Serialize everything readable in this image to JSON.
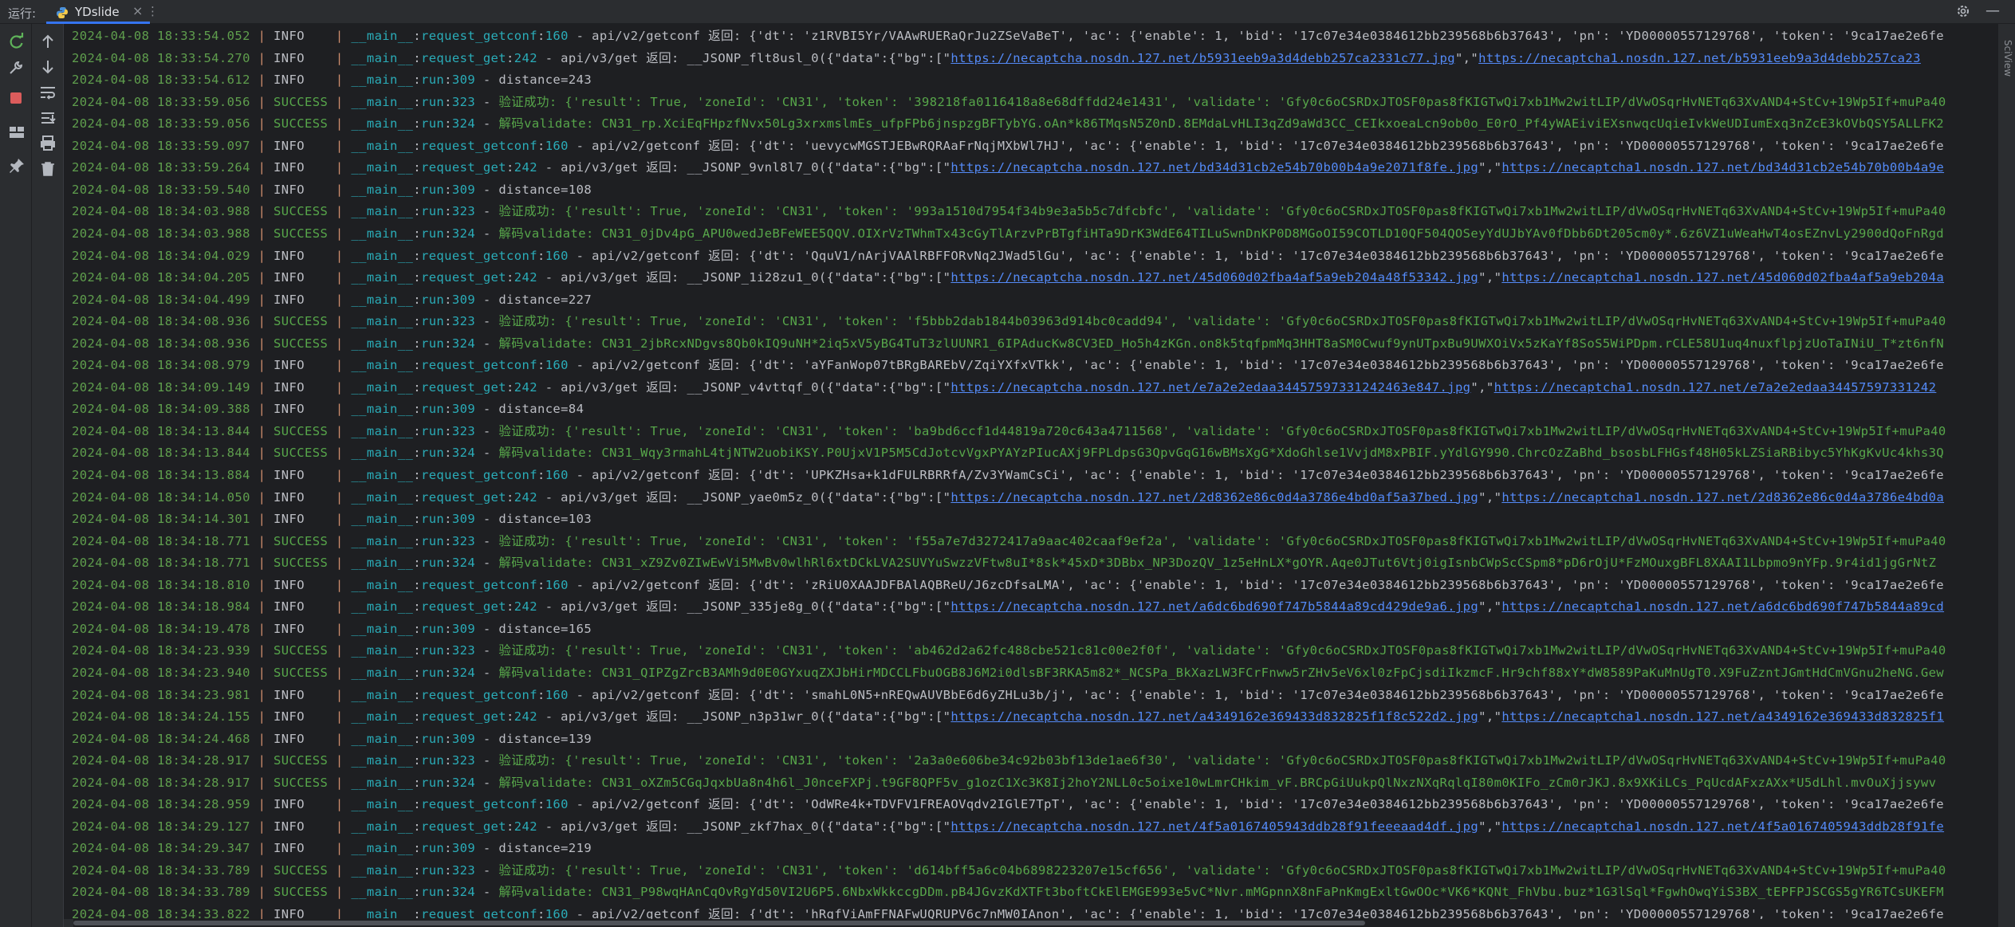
{
  "header": {
    "run_label": "运行:",
    "tab_title": "YDslide",
    "tab_close": "×",
    "tab_menu": "⋮",
    "minimize": "—"
  },
  "right_strip_label": "SciView",
  "icons": {
    "rerun": "rerun-icon",
    "settings": "wrench-icon",
    "stop": "stop-icon",
    "layout": "layout-icon",
    "pin": "pin-icon",
    "up": "arrow-up-icon",
    "down": "arrow-down-icon",
    "softwrap": "soft-wrap-icon",
    "scroll_end": "scroll-to-end-icon",
    "print": "print-icon",
    "trash": "trash-icon",
    "gear": "gear-icon",
    "python": "python-icon"
  },
  "colors": {
    "accent": "#3574f0",
    "success": "#57a64a",
    "timestamp": "#5f9e4d",
    "link": "#548af7",
    "stop": "#db5c5c"
  },
  "console": {
    "lines": [
      {
        "ts": "2024-04-08 18:33:54.052",
        "level": "INFO   ",
        "fn": "request_getconf",
        "ln": "160",
        "msg": "api/v2/getconf 返回: {'dt': 'z1RVBI5Yr/VAAwRUERaQrJu2ZSeVaBeT', 'ac': {'enable': 1, 'bid': '17c07e34e0384612bb239568b6b37643', 'pn': 'YD00000557129768', 'token': '9ca17ae2e6fe",
        "urls": []
      },
      {
        "ts": "2024-04-08 18:33:54.270",
        "level": "INFO   ",
        "fn": "request_get",
        "ln": "242",
        "msg": "api/v3/get 返回: __JSONP_flt8usl_0({\"data\":{\"bg\":[\"",
        "urls": [
          "https://necaptcha.nosdn.127.net/b5931eeb9a3d4debb257ca2331c77.jpg",
          "\",\"",
          "https://necaptcha1.nosdn.127.net/b5931eeb9a3d4debb257ca23"
        ]
      },
      {
        "ts": "2024-04-08 18:33:54.612",
        "level": "INFO   ",
        "fn": "run",
        "ln": "309",
        "msg": "distance=243",
        "urls": []
      },
      {
        "ts": "2024-04-08 18:33:59.056",
        "level": "SUCCESS",
        "fn": "run",
        "ln": "323",
        "msg": "验证成功: {'result': True, 'zoneId': 'CN31', 'token': '398218fa0116418a8e68dffdd24e1431', 'validate': 'Gfy0c6oCSRDxJTOSF0pas8fKIGTwQi7xb1Mw2witLIP/dVwOSqrHvNETq63XvAND4+StCv+19Wp5If+muPa40",
        "urls": []
      },
      {
        "ts": "2024-04-08 18:33:59.056",
        "level": "SUCCESS",
        "fn": "run",
        "ln": "324",
        "msg": "解码validate: CN31_rp.XciEqFHpzfNvx50Lg3xrxmslmEs_ufpFPb6jnspzgBFTybYG.oAn*k86TMqsN5Z0nD.8EMdaLvHLI3qZd9aWd3CC_CEIkxoeaLcn9ob0o_E0rO_Pf4yWAEiviEXsnwqcUqieIvkWeUDIumExq3nZcE3kOVbQSY5ALLFK2",
        "urls": []
      },
      {
        "ts": "2024-04-08 18:33:59.097",
        "level": "INFO   ",
        "fn": "request_getconf",
        "ln": "160",
        "msg": "api/v2/getconf 返回: {'dt': 'uevycwMGSTJEBwRQRAaFrNqjMXbWl7HJ', 'ac': {'enable': 1, 'bid': '17c07e34e0384612bb239568b6b37643', 'pn': 'YD00000557129768', 'token': '9ca17ae2e6fe",
        "urls": []
      },
      {
        "ts": "2024-04-08 18:33:59.264",
        "level": "INFO   ",
        "fn": "request_get",
        "ln": "242",
        "msg": "api/v3/get 返回: __JSONP_9vnl8l7_0({\"data\":{\"bg\":[\"",
        "urls": [
          "https://necaptcha.nosdn.127.net/bd34d31cb2e54b70b00b4a9e2071f8fe.jpg",
          "\",\"",
          "https://necaptcha1.nosdn.127.net/bd34d31cb2e54b70b00b4a9e"
        ]
      },
      {
        "ts": "2024-04-08 18:33:59.540",
        "level": "INFO   ",
        "fn": "run",
        "ln": "309",
        "msg": "distance=108",
        "urls": []
      },
      {
        "ts": "2024-04-08 18:34:03.988",
        "level": "SUCCESS",
        "fn": "run",
        "ln": "323",
        "msg": "验证成功: {'result': True, 'zoneId': 'CN31', 'token': '993a1510d7954f34b9e3a5b5c7dfcbfc', 'validate': 'Gfy0c6oCSRDxJTOSF0pas8fKIGTwQi7xb1Mw2witLIP/dVwOSqrHvNETq63XvAND4+StCv+19Wp5If+muPa40",
        "urls": []
      },
      {
        "ts": "2024-04-08 18:34:03.988",
        "level": "SUCCESS",
        "fn": "run",
        "ln": "324",
        "msg": "解码validate: CN31_0jDv4pG_APU0wedJeBFeWEE5QQV.OIXrVzTWhmTx43cGyTlArzvPrBTgfiHTa9DrK3WdE64TILuSwnDnKP0D8MGoOI59COTLD10QF504QOSeyYdUJbYAv0fDbb6Dt205cm0y*.6z6VZ1uWeaHwT4osEZnvLy2900dQoFnRgd",
        "urls": []
      },
      {
        "ts": "2024-04-08 18:34:04.029",
        "level": "INFO   ",
        "fn": "request_getconf",
        "ln": "160",
        "msg": "api/v2/getconf 返回: {'dt': 'QquV1/nArjVAAlRBFFORvNq2JWad5lGu', 'ac': {'enable': 1, 'bid': '17c07e34e0384612bb239568b6b37643', 'pn': 'YD00000557129768', 'token': '9ca17ae2e6fe",
        "urls": []
      },
      {
        "ts": "2024-04-08 18:34:04.205",
        "level": "INFO   ",
        "fn": "request_get",
        "ln": "242",
        "msg": "api/v3/get 返回: __JSONP_1i28zu1_0({\"data\":{\"bg\":[\"",
        "urls": [
          "https://necaptcha.nosdn.127.net/45d060d02fba4af5a9eb204a48f53342.jpg",
          "\",\"",
          "https://necaptcha1.nosdn.127.net/45d060d02fba4af5a9eb204a"
        ]
      },
      {
        "ts": "2024-04-08 18:34:04.499",
        "level": "INFO   ",
        "fn": "run",
        "ln": "309",
        "msg": "distance=227",
        "urls": []
      },
      {
        "ts": "2024-04-08 18:34:08.936",
        "level": "SUCCESS",
        "fn": "run",
        "ln": "323",
        "msg": "验证成功: {'result': True, 'zoneId': 'CN31', 'token': 'f5bbb2dab1844b03963d914bc0cadd94', 'validate': 'Gfy0c6oCSRDxJTOSF0pas8fKIGTwQi7xb1Mw2witLIP/dVwOSqrHvNETq63XvAND4+StCv+19Wp5If+muPa40",
        "urls": []
      },
      {
        "ts": "2024-04-08 18:34:08.936",
        "level": "SUCCESS",
        "fn": "run",
        "ln": "324",
        "msg": "解码validate: CN31_2jbRcxNDgvs8Qb0kIQ9uNH*2iq5xV5yBG4TuT3zlUUNR1_6IPAducKw8CV3ED_Ho5h4zKGn.on8k5tqfpmMq3HHT8aSM0Cwuf9ynUTpxBu9UWXOiVx5zKaYf8SoS5WiPDpm.rCLE58U1uq4nuxflpjzUoTaINiU_T*zt6nfN",
        "urls": []
      },
      {
        "ts": "2024-04-08 18:34:08.979",
        "level": "INFO   ",
        "fn": "request_getconf",
        "ln": "160",
        "msg": "api/v2/getconf 返回: {'dt': 'aYFanWop07tBRgBAREbV/ZqiYXfxVTkk', 'ac': {'enable': 1, 'bid': '17c07e34e0384612bb239568b6b37643', 'pn': 'YD00000557129768', 'token': '9ca17ae2e6fe",
        "urls": []
      },
      {
        "ts": "2024-04-08 18:34:09.149",
        "level": "INFO   ",
        "fn": "request_get",
        "ln": "242",
        "msg": "api/v3/get 返回: __JSONP_v4vttqf_0({\"data\":{\"bg\":[\"",
        "urls": [
          "https://necaptcha.nosdn.127.net/e7a2e2edaa34457597331242463e847.jpg",
          "\",\"",
          "https://necaptcha1.nosdn.127.net/e7a2e2edaa34457597331242"
        ]
      },
      {
        "ts": "2024-04-08 18:34:09.388",
        "level": "INFO   ",
        "fn": "run",
        "ln": "309",
        "msg": "distance=84",
        "urls": []
      },
      {
        "ts": "2024-04-08 18:34:13.844",
        "level": "SUCCESS",
        "fn": "run",
        "ln": "323",
        "msg": "验证成功: {'result': True, 'zoneId': 'CN31', 'token': 'ba9bd6ccf1d44819a720c643a4711568', 'validate': 'Gfy0c6oCSRDxJTOSF0pas8fKIGTwQi7xb1Mw2witLIP/dVwOSqrHvNETq63XvAND4+StCv+19Wp5If+muPa40",
        "urls": []
      },
      {
        "ts": "2024-04-08 18:34:13.844",
        "level": "SUCCESS",
        "fn": "run",
        "ln": "324",
        "msg": "解码validate: CN31_Wqy3rmahL4tjNTW2uobiKSY.P0UjxV1P5M5CdJotcvVgxPYAYzPIucAXj9FPLdpsG3QpvGqG16wBMsXgG*XdoGhlse1VvjdM8xPBIF.yYdlGY990.ChrcOzZaBhd_bsosbLFHGsf48H05kLZSiaRBibyc5YhKgKvUc4khs3Q",
        "urls": []
      },
      {
        "ts": "2024-04-08 18:34:13.884",
        "level": "INFO   ",
        "fn": "request_getconf",
        "ln": "160",
        "msg": "api/v2/getconf 返回: {'dt': 'UPKZHsa+k1dFULRBRRfA/Zv3YWamCsCi', 'ac': {'enable': 1, 'bid': '17c07e34e0384612bb239568b6b37643', 'pn': 'YD00000557129768', 'token': '9ca17ae2e6fe",
        "urls": []
      },
      {
        "ts": "2024-04-08 18:34:14.050",
        "level": "INFO   ",
        "fn": "request_get",
        "ln": "242",
        "msg": "api/v3/get 返回: __JSONP_yae0m5z_0({\"data\":{\"bg\":[\"",
        "urls": [
          "https://necaptcha.nosdn.127.net/2d8362e86c0d4a3786e4bd0af5a37bed.jpg",
          "\",\"",
          "https://necaptcha1.nosdn.127.net/2d8362e86c0d4a3786e4bd0a"
        ]
      },
      {
        "ts": "2024-04-08 18:34:14.301",
        "level": "INFO   ",
        "fn": "run",
        "ln": "309",
        "msg": "distance=103",
        "urls": []
      },
      {
        "ts": "2024-04-08 18:34:18.771",
        "level": "SUCCESS",
        "fn": "run",
        "ln": "323",
        "msg": "验证成功: {'result': True, 'zoneId': 'CN31', 'token': 'f55a7e7d3272417a9aac402caaf9ef2a', 'validate': 'Gfy0c6oCSRDxJTOSF0pas8fKIGTwQi7xb1Mw2witLIP/dVwOSqrHvNETq63XvAND4+StCv+19Wp5If+muPa40",
        "urls": []
      },
      {
        "ts": "2024-04-08 18:34:18.771",
        "level": "SUCCESS",
        "fn": "run",
        "ln": "324",
        "msg": "解码validate: CN31_xZ9Zv0ZIwEwVi5MwBv0wlhRl6xtDCkLVA2SUVYuSwzzVFtw8uI*8sk*45xD*3DBbx_NP3DozQV_1z5eHnLX*gOYR.Aqe0JTut6Vtj0igIsnbCWpScCSpm8*pD6rOjU*FzMOuxgBFL8XAAI1Lbpmo9nYFp.9r4id1jgGrNtZ",
        "urls": []
      },
      {
        "ts": "2024-04-08 18:34:18.810",
        "level": "INFO   ",
        "fn": "request_getconf",
        "ln": "160",
        "msg": "api/v2/getconf 返回: {'dt': 'zRiU0XAAJDFBAlAQBReU/J6zcDfsaLMA', 'ac': {'enable': 1, 'bid': '17c07e34e0384612bb239568b6b37643', 'pn': 'YD00000557129768', 'token': '9ca17ae2e6fe",
        "urls": []
      },
      {
        "ts": "2024-04-08 18:34:18.984",
        "level": "INFO   ",
        "fn": "request_get",
        "ln": "242",
        "msg": "api/v3/get 返回: __JSONP_335je8g_0({\"data\":{\"bg\":[\"",
        "urls": [
          "https://necaptcha.nosdn.127.net/a6dc6bd690f747b5844a89cd429de9a6.jpg",
          "\",\"",
          "https://necaptcha1.nosdn.127.net/a6dc6bd690f747b5844a89cd"
        ]
      },
      {
        "ts": "2024-04-08 18:34:19.478",
        "level": "INFO   ",
        "fn": "run",
        "ln": "309",
        "msg": "distance=165",
        "urls": []
      },
      {
        "ts": "2024-04-08 18:34:23.939",
        "level": "SUCCESS",
        "fn": "run",
        "ln": "323",
        "msg": "验证成功: {'result': True, 'zoneId': 'CN31', 'token': 'ab462d2a62fc488cbe521c81c00e2f0f', 'validate': 'Gfy0c6oCSRDxJTOSF0pas8fKIGTwQi7xb1Mw2witLIP/dVwOSqrHvNETq63XvAND4+StCv+19Wp5If+muPa40",
        "urls": []
      },
      {
        "ts": "2024-04-08 18:34:23.940",
        "level": "SUCCESS",
        "fn": "run",
        "ln": "324",
        "msg": "解码validate: CN31_QIPZgZrcB3AMh9d0E0GYxuqZXJbHirMDCCLFbuOGB8J6M2i0dlsBF3RKA5m82*_NCSPa_BkXazLW3FCrFnww5rZHv5eV6xl0zFpCjsdiIkzmcF.Hr9chf88xY*dW8589PaKuMnUgT0.X9FuZzntJGmtHdCmVGnu2heNG.Gew",
        "urls": []
      },
      {
        "ts": "2024-04-08 18:34:23.981",
        "level": "INFO   ",
        "fn": "request_getconf",
        "ln": "160",
        "msg": "api/v2/getconf 返回: {'dt': 'smahL0N5+nREQwAUVBbE6d6yZHLu3b/j', 'ac': {'enable': 1, 'bid': '17c07e34e0384612bb239568b6b37643', 'pn': 'YD00000557129768', 'token': '9ca17ae2e6fe",
        "urls": []
      },
      {
        "ts": "2024-04-08 18:34:24.155",
        "level": "INFO   ",
        "fn": "request_get",
        "ln": "242",
        "msg": "api/v3/get 返回: __JSONP_n3p31wr_0({\"data\":{\"bg\":[\"",
        "urls": [
          "https://necaptcha.nosdn.127.net/a4349162e369433d832825f1f8c522d2.jpg",
          "\",\"",
          "https://necaptcha1.nosdn.127.net/a4349162e369433d832825f1"
        ]
      },
      {
        "ts": "2024-04-08 18:34:24.468",
        "level": "INFO   ",
        "fn": "run",
        "ln": "309",
        "msg": "distance=139",
        "urls": []
      },
      {
        "ts": "2024-04-08 18:34:28.917",
        "level": "SUCCESS",
        "fn": "run",
        "ln": "323",
        "msg": "验证成功: {'result': True, 'zoneId': 'CN31', 'token': '2a3a0e606be34c92b03bf13de1ae6f30', 'validate': 'Gfy0c6oCSRDxJTOSF0pas8fKIGTwQi7xb1Mw2witLIP/dVwOSqrHvNETq63XvAND4+StCv+19Wp5If+muPa40",
        "urls": []
      },
      {
        "ts": "2024-04-08 18:34:28.917",
        "level": "SUCCESS",
        "fn": "run",
        "ln": "324",
        "msg": "解码validate: CN31_oXZm5CGqJqxbUa8n4h6l_J0nceFXPj.t9GF8QPF5v_g1ozC1Xc3K8Ij2hoY2NLL0c5oixe10wLmrCHkim_vF.BRCpGiUukpQlNxzNXqRqlqI80m0KIFo_zCm0rJKJ.8x9XKiLCs_PqUcdAFxzAXx*U5dLhl.mvOuXjjsywv",
        "urls": []
      },
      {
        "ts": "2024-04-08 18:34:28.959",
        "level": "INFO   ",
        "fn": "request_getconf",
        "ln": "160",
        "msg": "api/v2/getconf 返回: {'dt': 'OdWRe4k+TDVFV1FREAOVqdv2IGlE7TpT', 'ac': {'enable': 1, 'bid': '17c07e34e0384612bb239568b6b37643', 'pn': 'YD00000557129768', 'token': '9ca17ae2e6fe",
        "urls": []
      },
      {
        "ts": "2024-04-08 18:34:29.127",
        "level": "INFO   ",
        "fn": "request_get",
        "ln": "242",
        "msg": "api/v3/get 返回: __JSONP_zkf7hax_0({\"data\":{\"bg\":[\"",
        "urls": [
          "https://necaptcha.nosdn.127.net/4f5a0167405943ddb28f91feeeaad4df.jpg",
          "\",\"",
          "https://necaptcha1.nosdn.127.net/4f5a0167405943ddb28f91fe"
        ]
      },
      {
        "ts": "2024-04-08 18:34:29.347",
        "level": "INFO   ",
        "fn": "run",
        "ln": "309",
        "msg": "distance=219",
        "urls": []
      },
      {
        "ts": "2024-04-08 18:34:33.789",
        "level": "SUCCESS",
        "fn": "run",
        "ln": "323",
        "msg": "验证成功: {'result': True, 'zoneId': 'CN31', 'token': 'd614bff5a6c04b6898223207e15cf656', 'validate': 'Gfy0c6oCSRDxJTOSF0pas8fKIGTwQi7xb1Mw2witLIP/dVwOSqrHvNETq63XvAND4+StCv+19Wp5If+muPa40",
        "urls": []
      },
      {
        "ts": "2024-04-08 18:34:33.789",
        "level": "SUCCESS",
        "fn": "run",
        "ln": "324",
        "msg": "解码validate: CN31_P98wqHAnCqOvRgYd50VI2U6P5.6NbxWkkccgDDm.pB4JGvzKdXTFt3boftCkElEMGE993e5vC*Nvr.mMGpnnX8nFaPnKmgExltGwOOc*VK6*KQNt_FhVbu.buz*1G3lSql*FgwhOwqYiS3BX_tEPFPJSCGS5gYR6TCsUKEFM",
        "urls": []
      },
      {
        "ts": "2024-04-08 18:34:33.822",
        "level": "INFO   ",
        "fn": "request_getconf",
        "ln": "160",
        "msg": "api/v2/getconf 返回: {'dt': 'hRgfViAmFFNAFwUQRUPV6c7nMW0IAnon', 'ac': {'enable': 1, 'bid': '17c07e34e0384612bb239568b6b37643', 'pn': 'YD00000557129768', 'token': '9ca17ae2e6fe",
        "urls": []
      }
    ],
    "sep": "|",
    "module": "__main__"
  }
}
